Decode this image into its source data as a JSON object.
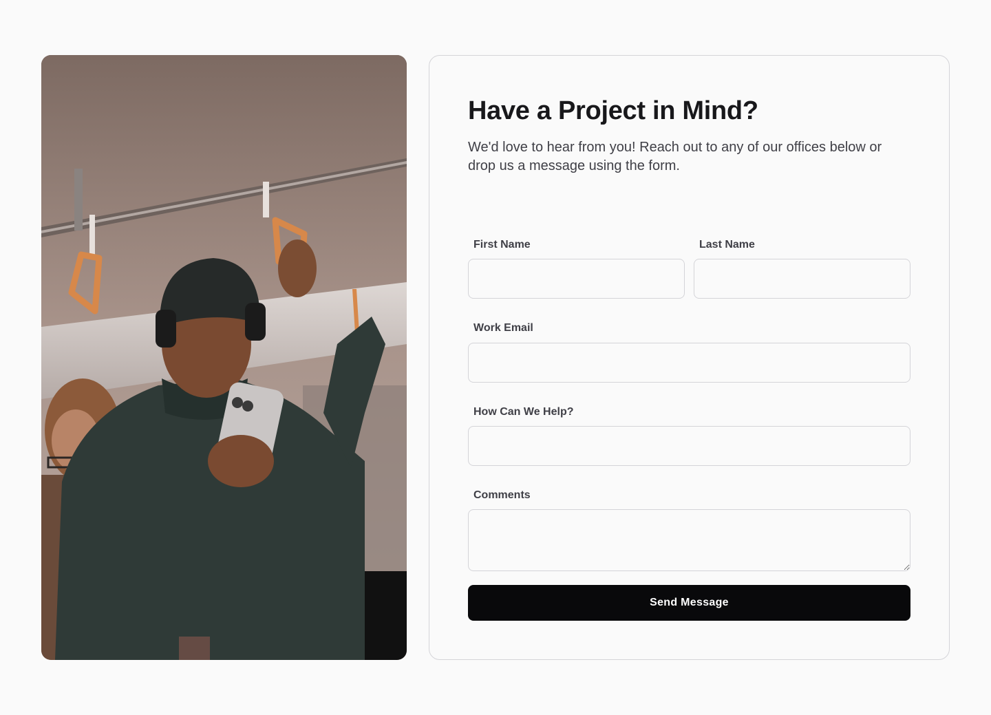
{
  "photo": {
    "subject": "subway-commuter-photo"
  },
  "contact": {
    "title": "Have a Project in Mind?",
    "subtitle": "We'd love to hear from you! Reach out to any of our offices below or drop us a message using the form.",
    "first_name_label": "First Name",
    "last_name_label": "Last Name",
    "work_email_label": "Work Email",
    "help_label": "How Can We Help?",
    "comments_label": "Comments",
    "first_name_value": "",
    "last_name_value": "",
    "work_email_value": "",
    "help_value": "",
    "comments_value": "",
    "submit_label": "Send Message"
  },
  "colors": {
    "background": "#fafafa",
    "button": "#09090b",
    "border": "#d4d4d8"
  }
}
